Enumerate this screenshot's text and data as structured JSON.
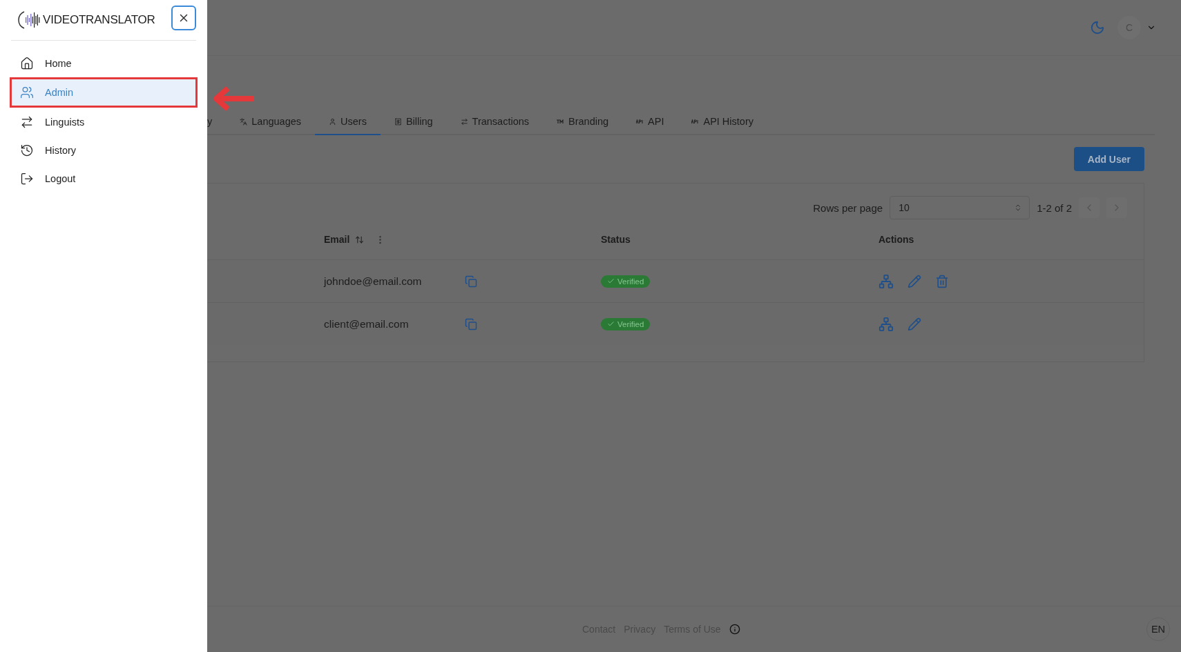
{
  "sidebar": {
    "logo": "VIDEOTRANSLATOR",
    "items": [
      {
        "label": "Home",
        "selected": false,
        "highlighted": false
      },
      {
        "label": "Admin",
        "selected": true,
        "highlighted": true
      },
      {
        "label": "Linguists",
        "selected": false,
        "highlighted": false
      },
      {
        "label": "History",
        "selected": false,
        "highlighted": false
      },
      {
        "label": "Logout",
        "selected": false,
        "highlighted": false
      }
    ]
  },
  "header": {
    "avatar": "C"
  },
  "tabs": [
    {
      "label": "y",
      "selected": false
    },
    {
      "label": "Languages",
      "selected": false
    },
    {
      "label": "Users",
      "selected": true
    },
    {
      "label": "Billing",
      "selected": false
    },
    {
      "label": "Transactions",
      "selected": false
    },
    {
      "label": "Branding",
      "selected": false
    },
    {
      "label": "API",
      "selected": false
    },
    {
      "label": "API History",
      "selected": false
    }
  ],
  "add_button": "Add User",
  "pagination": {
    "label": "Rows per page",
    "value": "10",
    "range": "1-2 of 2"
  },
  "table": {
    "columns": [
      "Email",
      "Status",
      "Actions"
    ],
    "rows": [
      {
        "email": "johndoe@email.com",
        "status": "Verified",
        "can_delete": true
      },
      {
        "email": "client@email.com",
        "status": "Verified",
        "can_delete": false
      }
    ]
  },
  "footer": {
    "links": [
      "Contact",
      "Privacy",
      "Terms of Use"
    ],
    "language": "EN"
  }
}
